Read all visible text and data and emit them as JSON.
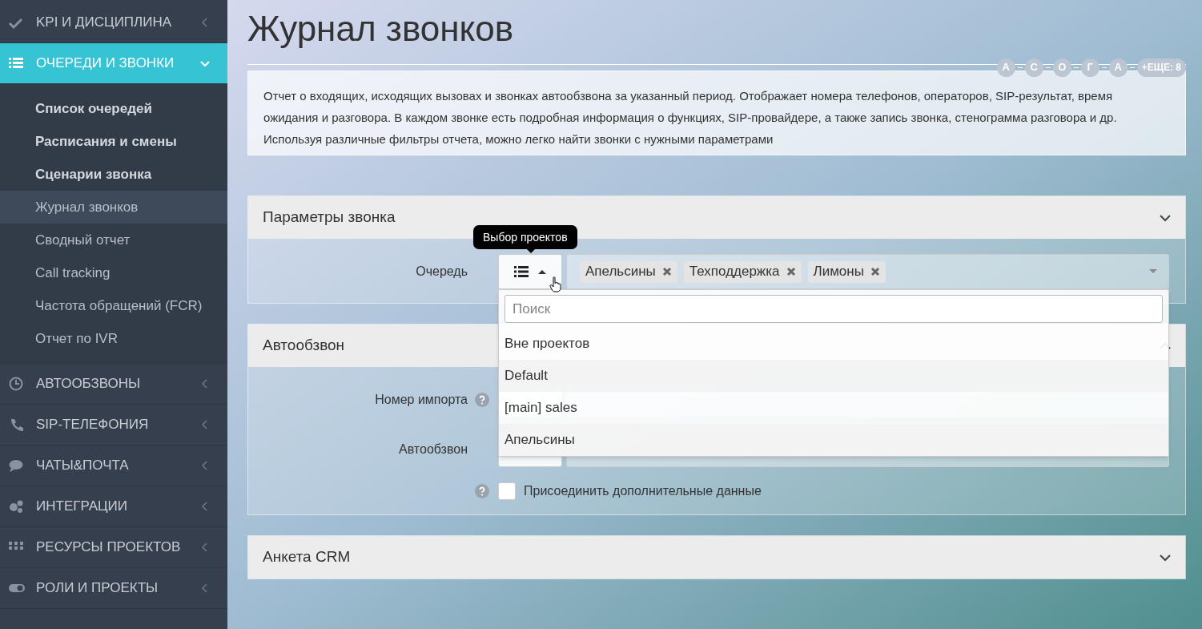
{
  "sidebar": {
    "items": [
      {
        "label": "KPI И ДИСЦИПЛИНА",
        "selected": false,
        "expanded": false
      },
      {
        "label": "ОЧЕРЕДИ И ЗВОНКИ",
        "selected": true,
        "expanded": true,
        "children": [
          {
            "label": "Список очередей",
            "kind": "group",
            "selected": false
          },
          {
            "label": "Расписания и смены",
            "kind": "group",
            "selected": false
          },
          {
            "label": "Сценарии звонка",
            "kind": "group",
            "selected": false
          },
          {
            "label": "Журнал звонков",
            "kind": "link",
            "selected": true
          },
          {
            "label": "Сводный отчет",
            "kind": "link",
            "selected": false
          },
          {
            "label": "Call tracking",
            "kind": "link",
            "selected": false
          },
          {
            "label": "Частота обращений (FCR)",
            "kind": "link",
            "selected": false
          },
          {
            "label": "Отчет по IVR",
            "kind": "link",
            "selected": false
          }
        ]
      },
      {
        "label": "АВТООБЗВОНЫ",
        "selected": false,
        "expanded": false
      },
      {
        "label": "SIP-ТЕЛЕФОНИЯ",
        "selected": false,
        "expanded": false
      },
      {
        "label": "ЧАТЫ&ПОЧТА",
        "selected": false,
        "expanded": false
      },
      {
        "label": "ИНТЕГРАЦИИ",
        "selected": false,
        "expanded": false
      },
      {
        "label": "РЕСУРСЫ ПРОЕКТОВ",
        "selected": false,
        "expanded": false
      },
      {
        "label": "РОЛИ И ПРОЕКТЫ",
        "selected": false,
        "expanded": false
      }
    ]
  },
  "page": {
    "title": "Журнал звонков",
    "users": [
      "А",
      "С",
      "О",
      "Г",
      "А"
    ],
    "more_users": "+ЕЩЕ: 8",
    "description": "Отчет о входящих, исходящих вызовах и звонках автообзвона за указанный период. Отображает номера телефонов, операторов, SIP-результат, время ожидания и разговора. В каждом звонке есть подробная информация о функциях, SIP-провайдере, а также запись звонка, стенограмма разговора и др. Используя различные фильтры отчета, можно легко найти звонки с нужными параметрами"
  },
  "panels": [
    {
      "title": "Параметры звонка",
      "expanded": true,
      "chevron_up": false,
      "rows": [
        {
          "kind": "queue",
          "label": "Очередь",
          "tooltip": "Выбор проектов",
          "tags": [
            "Апельсины",
            "Техподдержка",
            "Лимоны"
          ],
          "dropdown": {
            "open": true,
            "placeholder": "Поиск",
            "options": [
              "Вне проектов",
              "Default",
              "[main] sales",
              "Апельсины"
            ]
          }
        }
      ]
    },
    {
      "title": "Автообзвон",
      "expanded": true,
      "chevron_up": true,
      "rows": [
        {
          "kind": "select",
          "label": "Номер импорта",
          "help": true
        },
        {
          "kind": "select",
          "label": "Автообзвон",
          "help": false
        },
        {
          "kind": "checkbox",
          "label": "Присоединить дополнительные данные",
          "help": true,
          "checked": false
        }
      ]
    },
    {
      "title": "Анкета CRM",
      "expanded": false,
      "chevron_up": false
    }
  ]
}
